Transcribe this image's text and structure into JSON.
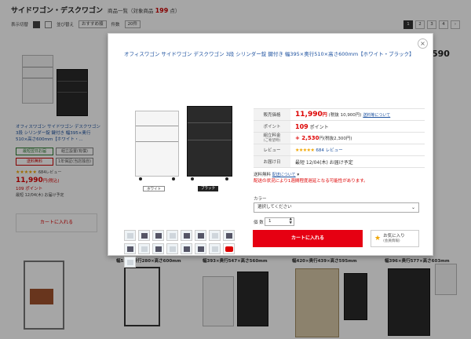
{
  "page": {
    "title": "サイドワゴン・デスクワゴン",
    "subtitle_prefix": "商品一覧（対象商品",
    "count": "199",
    "subtitle_suffix": "点）"
  },
  "toolbar": {
    "view_label": "表示切替",
    "sort_label": "並び替え",
    "sort_value": "おすすめ順",
    "count_label": "件数",
    "count_value": "20件",
    "pages": [
      "1",
      "2",
      "3",
      "4",
      "›"
    ]
  },
  "bg_product": {
    "name": "オフィスワゴン サイドワゴン デスクワゴン 3段 シリンダー錠 鍵付き 幅395×奥行510×高さ600mm【ホワイト・...",
    "tags": [
      "最短翌日お届",
      "組立設置(有償)",
      "送料無料",
      "1年保証(当店独自)"
    ],
    "stars": "★★★★★",
    "review_text": "684レビュー",
    "price": "11,990",
    "price_suffix": "円(税込)",
    "points": "109 ポイント",
    "delivery": "最短 12/04(木) お届け予定",
    "cart_label": "カートに入れる"
  },
  "bg_right": {
    "price_partial": "590"
  },
  "bottom_labels": [
    "幅530×奥行280×高さ600mm",
    "幅393×奥行547×高さ560mm",
    "幅420×奥行439×高さ595mm",
    "幅396×奥行577×高さ603mm"
  ],
  "modal": {
    "title": "オフィスワゴン サイドワゴン デスクワゴン 3段 シリンダー錠 鍵付き 幅395×奥行510×高さ600mm【ホワイト・ブラック】",
    "close": "×",
    "captions": {
      "white": "ホワイト",
      "black": "ブラック"
    },
    "spec": {
      "price_label": "販売価格",
      "price_value": "11,990",
      "price_yen": "円",
      "price_tax": "(税抜 10,900円)",
      "price_link": "送料等について",
      "points_label": "ポイント",
      "points_value": "109",
      "points_unit": "ポイント",
      "assembly_label": "組立料金",
      "assembly_note": "(ご希望時)",
      "assembly_value": "+ 2,530",
      "assembly_tax": "円(税抜2,300円)",
      "review_label": "レビュー",
      "review_stars": "★★★★★",
      "review_count": "684 レビュー",
      "delivery_label": "お届け日",
      "delivery_value": "最短 12/04(木) お届け予定"
    },
    "shipping": {
      "label": "送料無料",
      "link": "配送について",
      "warning": "配送の状況により1週間程度遅延となる可能性があります。"
    },
    "color_label": "カラー",
    "color_placeholder": "選択してください",
    "qty_label": "個 数",
    "qty_value": "1",
    "cart_button": "カートに入れる",
    "fav_label": "お気に入り",
    "fav_sub": "(会員情報)"
  }
}
